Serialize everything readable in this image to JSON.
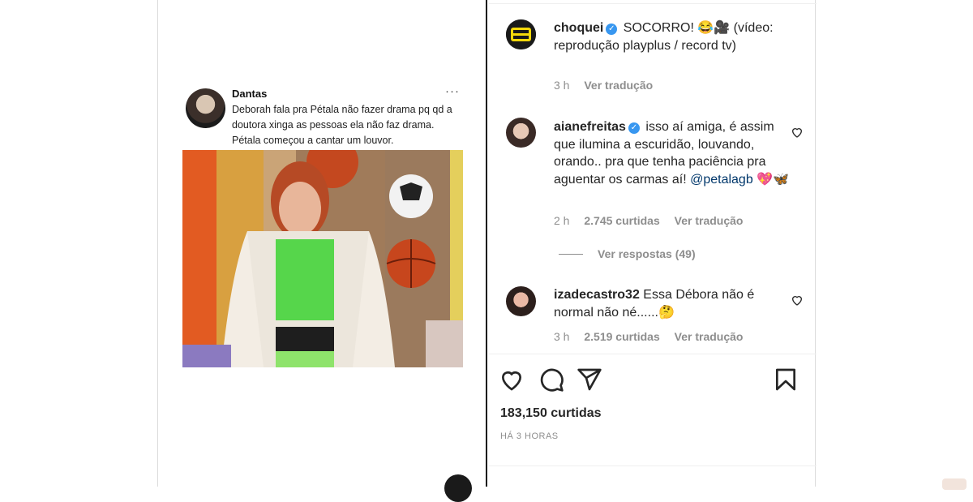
{
  "tweet": {
    "name": "Dantas",
    "more": "···",
    "text": "Deborah fala pra Pétala não fazer drama pq qd a doutora xinga as pessoas ela não faz drama. Pétala começou a cantar um louvor."
  },
  "caption": {
    "username": "choquei",
    "text": "SOCORRO! 😂🎥 (vídeo: reprodução playplus / record tv)",
    "time": "3 h",
    "translate": "Ver tradução"
  },
  "comments": [
    {
      "username": "aianefreitas",
      "text": "isso aí amiga, é assim que ilumina a escuridão, louvando, orando.. pra que tenha paciência pra aguentar os carmas aí!",
      "mention": "@petalagb",
      "emoji": "💖🦋",
      "time": "2 h",
      "likes": "2.745 curtidas",
      "translate": "Ver tradução"
    },
    {
      "username": "izadecastro32",
      "text": "Essa Débora não é normal não né......🤔",
      "time": "3 h",
      "likes": "2.519 curtidas",
      "translate": "Ver tradução"
    }
  ],
  "replies_label": "Ver respostas (49)",
  "actions": {
    "like_icon": "heart-icon",
    "comment_icon": "comment-icon",
    "share_icon": "send-icon",
    "save_icon": "bookmark-icon"
  },
  "likes_count": "183,150 curtidas",
  "post_time": "HÁ 3 HORAS",
  "colors": {
    "verified": "#3897f0",
    "muted": "#8e8e8e",
    "mention": "#00376b",
    "choquei_brand": "#f5d90a"
  }
}
